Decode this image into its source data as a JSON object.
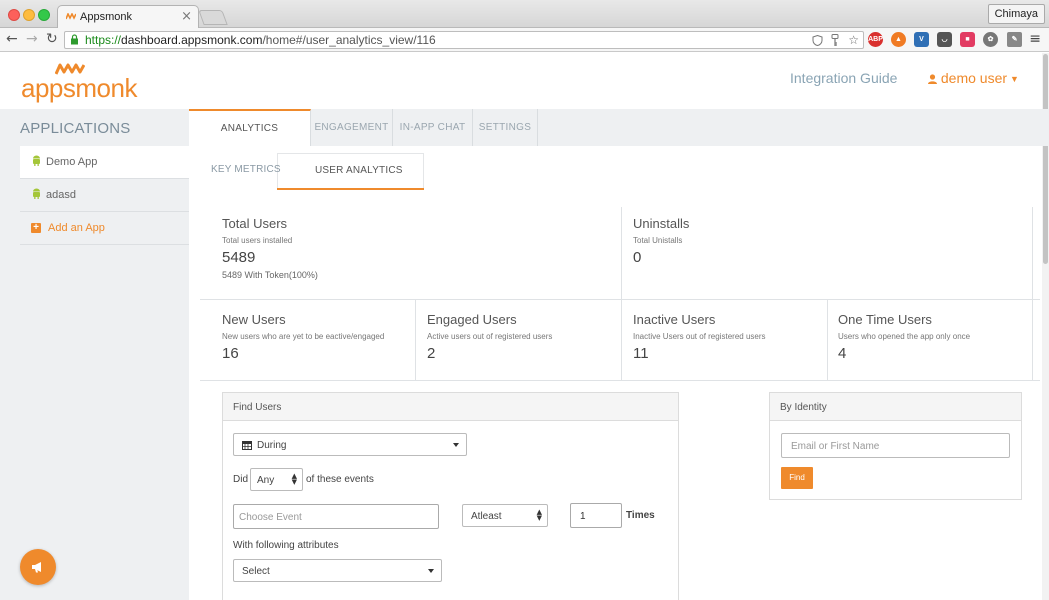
{
  "browser": {
    "tab_title": "Appsmonk",
    "tab_close": "×",
    "profile_name": "Chimaya",
    "url_scheme": "https://",
    "url_host": "dashboard.appsmonk.com",
    "url_path": "/home#/user_analytics_view/116",
    "back_icon": "←",
    "forward_icon": "→",
    "reload_icon": "↻",
    "menu_icon": "≡",
    "ext_abp": "ABP"
  },
  "header": {
    "logo_text": "appsmonk",
    "integration_guide": "Integration Guide",
    "user_label": "demo user",
    "caret": "▼"
  },
  "sidebar": {
    "title": "APPLICATIONS",
    "apps": [
      {
        "label": "Demo App"
      },
      {
        "label": "adasd"
      }
    ],
    "add_app": "Add an App",
    "plus": "+"
  },
  "tabs": {
    "main": [
      "ANALYTICS",
      "ENGAGEMENT",
      "IN-APP CHAT",
      "SETTINGS"
    ],
    "sub": [
      "KEY METRICS",
      "USER ANALYTICS"
    ]
  },
  "stats": {
    "total_users": {
      "title": "Total Users",
      "sub": "Total users installed",
      "value": "5489",
      "extra": "5489 With Token(100%)"
    },
    "uninstalls": {
      "title": "Uninstalls",
      "sub": "Total Unistalls",
      "value": "0"
    },
    "new_users": {
      "title": "New Users",
      "sub": "New users who are yet to be eactive/engaged",
      "value": "16"
    },
    "engaged_users": {
      "title": "Engaged Users",
      "sub": "Active users out of registered users",
      "value": "2"
    },
    "inactive_users": {
      "title": "Inactive Users",
      "sub": "Inactive Users out of registered users",
      "value": "11"
    },
    "one_time_users": {
      "title": "One Time Users",
      "sub": "Users who opened the app only once",
      "value": "4"
    }
  },
  "find_users": {
    "title": "Find Users",
    "during": "During",
    "did_label": "Did",
    "any_select": "Any",
    "events_label": "of these events",
    "event_placeholder": "Choose Event",
    "atleast": "Atleast",
    "times_value": "1",
    "times_label": "Times",
    "attributes_label": "With following attributes",
    "attr_select": "Select"
  },
  "by_identity": {
    "title": "By Identity",
    "placeholder": "Email or First Name",
    "find_button": "Find"
  },
  "colors": {
    "brand": "#ef8a2c",
    "sidebar_bg": "#eef0f2",
    "link_blue_grey": "#8aa4b4"
  }
}
